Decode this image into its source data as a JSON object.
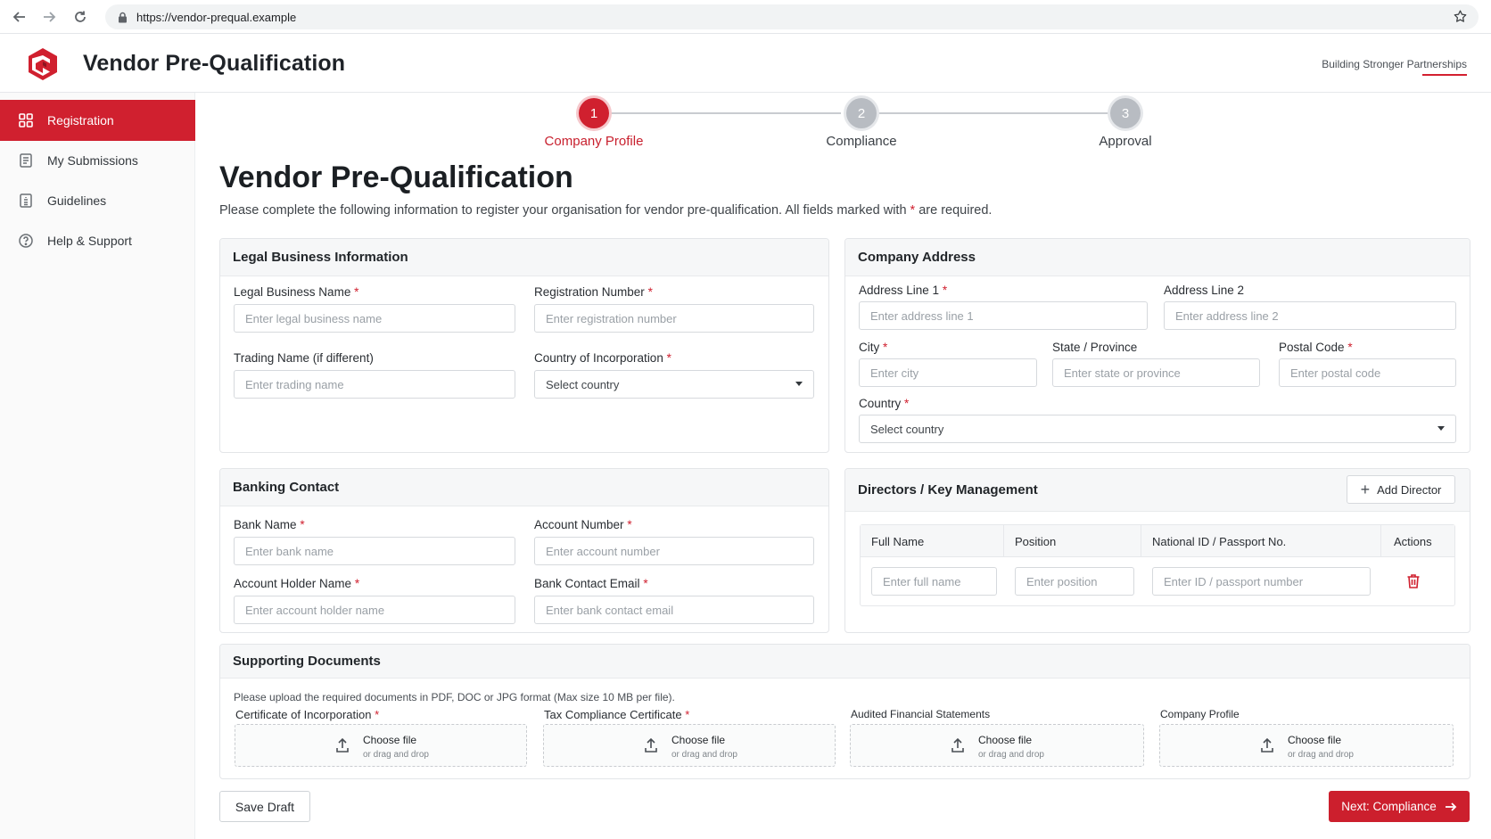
{
  "browser": {
    "url": "https://vendor-prequal.example",
    "icons": [
      "back-icon",
      "forward-icon",
      "reload-icon",
      "lock-icon",
      "star-icon"
    ]
  },
  "header": {
    "title": "Vendor Pre-Qualification",
    "tagline": "Building Stronger Partnerships",
    "brand_color": "#d0202f"
  },
  "sidebar": {
    "items": [
      {
        "label": "Registration",
        "icon": "grid-icon",
        "active": true
      },
      {
        "label": "My Submissions",
        "icon": "document-icon",
        "active": false
      },
      {
        "label": "Guidelines",
        "icon": "book-icon",
        "active": false
      },
      {
        "label": "Help & Support",
        "icon": "help-icon",
        "active": false
      }
    ]
  },
  "stepper": {
    "steps": [
      {
        "number": "1",
        "label": "Company Profile",
        "active": true
      },
      {
        "number": "2",
        "label": "Compliance",
        "active": false
      },
      {
        "number": "3",
        "label": "Approval",
        "active": false
      }
    ]
  },
  "page": {
    "title": "Vendor Pre-Qualification",
    "intro_before": "Please complete the following information to register your organisation for vendor pre-qualification. All fields marked with",
    "intro_star": "*",
    "intro_after": "are required."
  },
  "required_mark": "*",
  "legal": {
    "title": "Legal Business Information",
    "legal_name_label": "Legal Business Name",
    "legal_name_placeholder": "Enter legal business name",
    "reg_number_label": "Registration Number",
    "reg_number_placeholder": "Enter registration number",
    "trading_name_label": "Trading Name (if different)",
    "trading_name_placeholder": "Enter trading name",
    "country_label": "Country of Incorporation",
    "country_value": "Select country"
  },
  "address": {
    "title": "Company Address",
    "line1_label": "Address Line 1",
    "line1_placeholder": "Enter address line 1",
    "line2_label": "Address Line 2",
    "line2_placeholder": "Enter address line 2",
    "city_label": "City",
    "city_placeholder": "Enter city",
    "state_label": "State / Province",
    "state_placeholder": "Enter state or province",
    "postal_label": "Postal Code",
    "postal_placeholder": "Enter postal code",
    "country_label": "Country",
    "country_value": "Select country"
  },
  "banking": {
    "title": "Banking Contact",
    "bank_name_label": "Bank Name",
    "bank_name_placeholder": "Enter bank name",
    "account_number_label": "Account Number",
    "account_number_placeholder": "Enter account number",
    "holder_label": "Account Holder Name",
    "holder_placeholder": "Enter account holder name",
    "email_label": "Bank Contact Email",
    "email_placeholder": "Enter bank contact email"
  },
  "directors": {
    "title": "Directors / Key Management",
    "add_button": "Add Director",
    "columns": [
      "Full Name",
      "Position",
      "National ID / Passport No.",
      "Actions"
    ],
    "row": {
      "name_placeholder": "Enter full name",
      "position_placeholder": "Enter position",
      "id_placeholder": "Enter ID / passport number"
    }
  },
  "documents": {
    "title": "Supporting Documents",
    "hint": "Please upload the required documents in PDF, DOC or JPG format (Max size 10 MB per file).",
    "choose_label": "Choose file",
    "drag_label": "or drag and drop",
    "items": [
      {
        "label": "Certificate of Incorporation",
        "required": true
      },
      {
        "label": "Tax Compliance Certificate",
        "required": true
      },
      {
        "label": "Audited Financial Statements",
        "required": false
      },
      {
        "label": "Company Profile",
        "required": false
      }
    ]
  },
  "footer": {
    "save_draft": "Save Draft",
    "next": "Next: Compliance"
  }
}
